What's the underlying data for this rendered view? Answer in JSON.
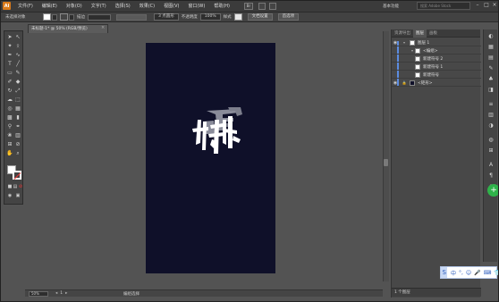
{
  "app": {
    "logo": "Ai",
    "workspace": "基本功能",
    "search_placeholder": "搜索 Adobe Stock"
  },
  "menu": [
    "文件(F)",
    "编辑(E)",
    "对象(O)",
    "文字(T)",
    "选择(S)",
    "效果(C)",
    "视图(V)",
    "窗口(W)",
    "帮助(H)"
  ],
  "bridge_label": "Br",
  "controlbar": {
    "selection_label": "未选择对象",
    "stroke_label": "描边",
    "profile": "3 点圆形",
    "opacity_label": "不透明度",
    "opacity_value": "100%",
    "style_label": "样式",
    "doc_setup": "文档设置",
    "preferences": "首选项"
  },
  "document": {
    "tab_title": "未标题-1* @ 50% (RGB/预览)",
    "close": "×"
  },
  "statusbar": {
    "zoom": "50%",
    "page": "1",
    "status": "编组选择"
  },
  "layers_panel": {
    "tabs": [
      "资源导出",
      "图层",
      "画板"
    ],
    "active_tab": "图层",
    "layers": [
      {
        "name": "图层 1",
        "indent": 0
      },
      {
        "name": "<编组>",
        "indent": 1
      },
      {
        "name": "新建符号 2",
        "indent": 2
      },
      {
        "name": "新建符号 1",
        "indent": 2
      },
      {
        "name": "新建符号",
        "indent": 2
      },
      {
        "name": "<矩形>",
        "indent": 1
      }
    ],
    "footer": "1 个图层"
  },
  "ime": {
    "items": [
      "中",
      "°,",
      "☺",
      "🎤",
      "⌨",
      "👕",
      "⁂"
    ]
  },
  "colors": {
    "artboard": "#0f1029",
    "accent": "#d97a1a",
    "selection": "#5b8be0",
    "badge": "#2fb34a"
  },
  "icons": [
    "selection-icon",
    "direct-selection-icon",
    "pen-icon",
    "type-icon",
    "line-icon",
    "rectangle-icon",
    "brush-icon",
    "pencil-icon",
    "eraser-icon",
    "rotate-icon",
    "scale-icon",
    "warp-icon",
    "free-transform-icon",
    "shape-builder-icon",
    "perspective-icon",
    "mesh-icon",
    "gradient-icon",
    "eyedropper-icon",
    "blend-icon",
    "symbol-sprayer-icon",
    "graph-icon",
    "artboard-icon",
    "slice-icon",
    "hand-icon",
    "zoom-icon"
  ]
}
